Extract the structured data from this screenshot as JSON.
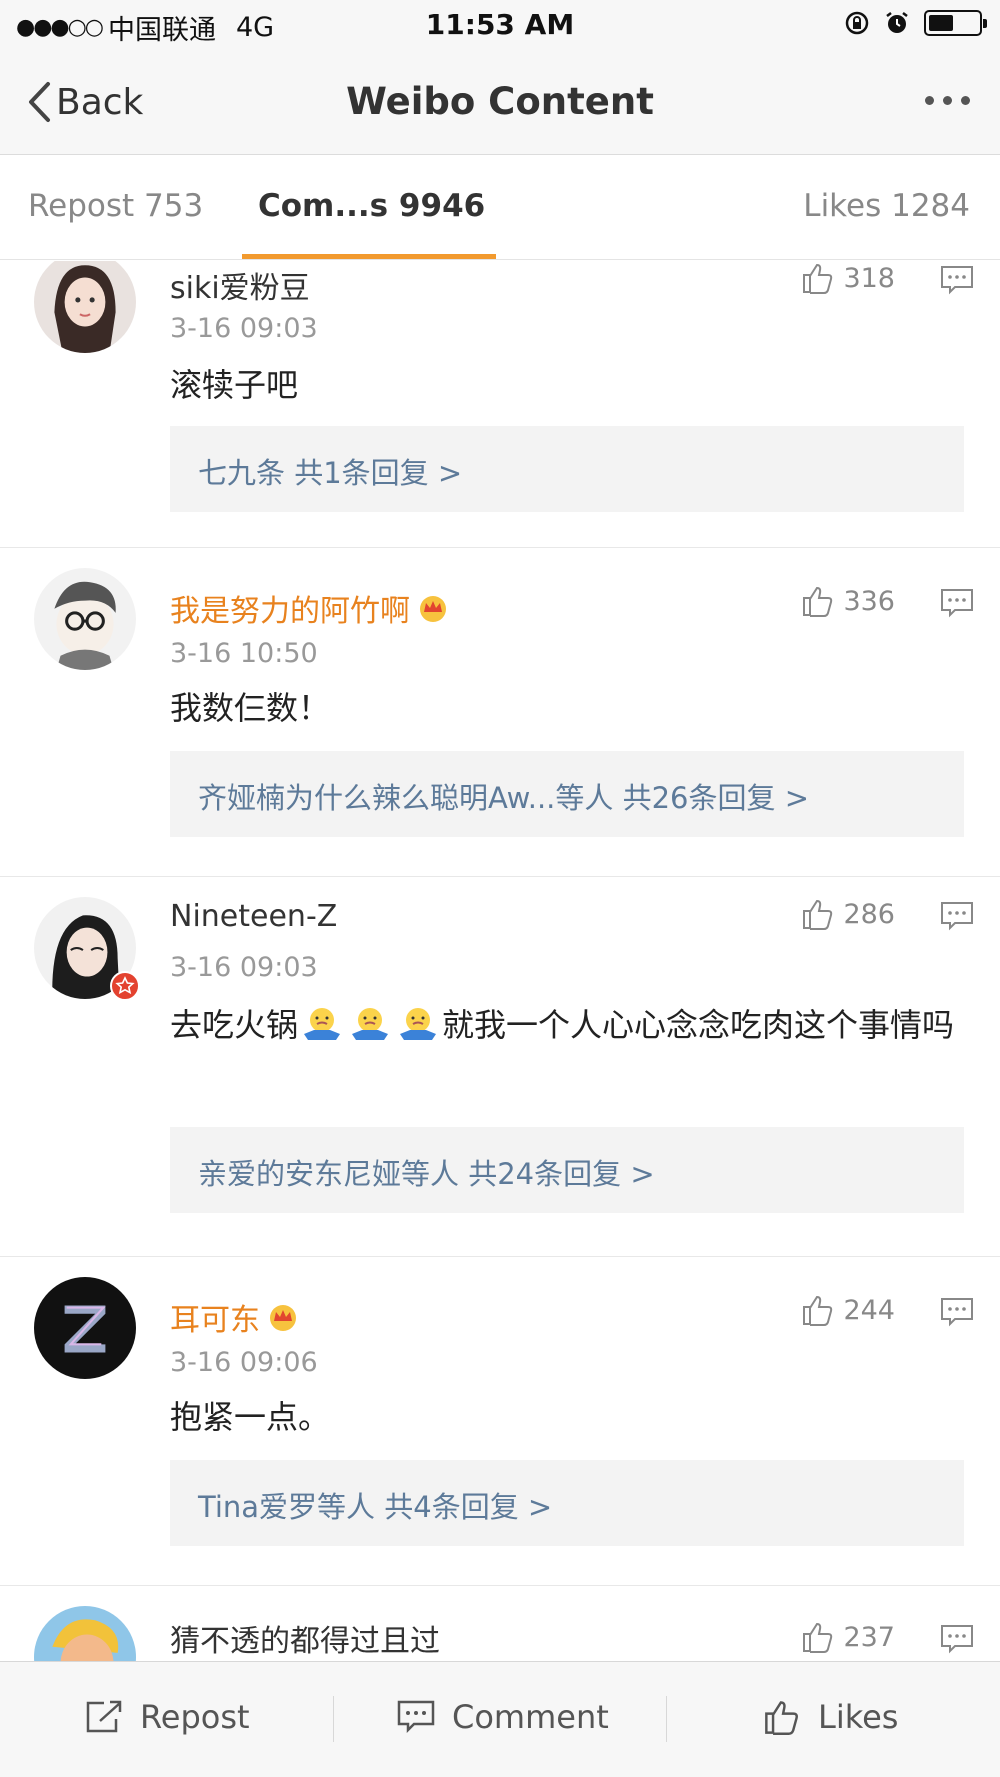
{
  "status_bar": {
    "carrier": "中国联通",
    "network": "4G",
    "time": "11:53 AM"
  },
  "nav": {
    "back_label": "Back",
    "title": "Weibo Content",
    "more_icon": "more-icon"
  },
  "tabs": [
    {
      "label": "Repost 753"
    },
    {
      "label": "Com...s 9946",
      "active": true
    },
    {
      "label": "Likes 1284"
    }
  ],
  "comments": [
    {
      "username": "siki爱粉豆",
      "vip": false,
      "time": "3-16 09:03",
      "text": "滚犊子吧",
      "likes": "318",
      "replies": "七九条  共1条回复 >"
    },
    {
      "username": "我是努力的阿竹啊",
      "vip": true,
      "time": "3-16 10:50",
      "text": "我数仨数！",
      "likes": "336",
      "replies": "齐娅楠为什么辣么聪明Aw...等人  共26条回复 >"
    },
    {
      "username": "Nineteen-Z",
      "vip": false,
      "verified": true,
      "time": "3-16 09:03",
      "text_part1": "去吃火锅",
      "text_part2": "就我一个人心心念念吃肉这个事情吗",
      "likes": "286",
      "replies": "亲爱的安东尼娅等人  共24条回复 >"
    },
    {
      "username": "耳可东",
      "vip": true,
      "time": "3-16 09:06",
      "text": "抱紧一点。",
      "likes": "244",
      "replies": "Tina爱罗等人  共4条回复 >"
    },
    {
      "username": "猜不透的都得过且过",
      "vip": false,
      "likes": "237"
    }
  ],
  "bottom_bar": {
    "repost_label": "Repost",
    "comment_label": "Comment",
    "likes_label": "Likes"
  },
  "colors": {
    "accent": "#f29a2e",
    "vip_name": "#e8821e",
    "reply_link": "#5d7a99"
  }
}
